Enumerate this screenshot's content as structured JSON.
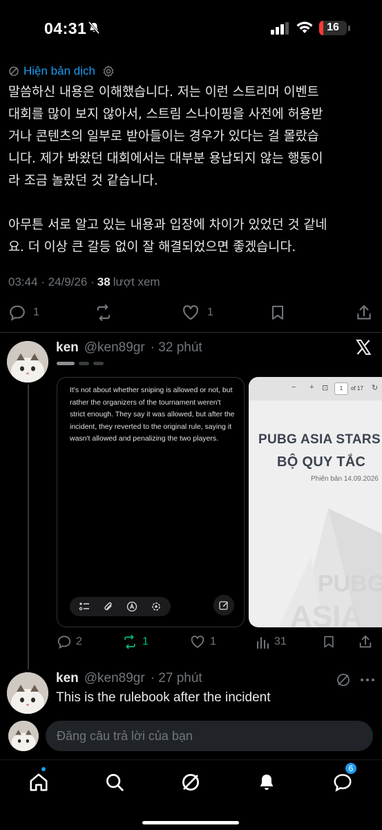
{
  "status_bar": {
    "time": "04:31",
    "battery": "16",
    "battery_level": 0.16
  },
  "tweet": {
    "translate_label": "Hiện bản dịch",
    "text": "말씀하신 내용은 이해했습니다. 저는 이런 스트리머 이벤트\n대회를 많이 보지 않아서, 스트림 스나이핑을 사전에 허용받\n거나 콘텐츠의 일부로 받아들이는 경우가 있다는 걸 몰랐습\n니다. 제가 봐왔던 대회에서는 대부분 용납되지 않는 행동이\n라 조금 놀랐던 것 같습니다.\n\n아무튼 서로 알고 있는 내용과 입장에 차이가 있었던 것 같네\n요. 더 이상 큰 갈등 없이 잘 해결되었으면 좋겠습니다.",
    "timestamp": "03:44 · 24/9/26 ·",
    "views_count": "38",
    "views_label": "lượt xem",
    "replies": "1",
    "likes": "1"
  },
  "reply1": {
    "name": "ken",
    "handle": "@ken89gr",
    "time": "· 32 phút",
    "note_text": "It's not about whether sniping is allowed or not, but rather the organizers of the tournament weren't strict enough. They say it was allowed, but after the incident, they reverted to the original rule, saying it wasn't allowed and penalizing the two players.",
    "pdf": {
      "page": "1",
      "of": "of 17",
      "title1": "PUBG ASIA STARS",
      "title2": "BỘ QUY TẮC",
      "version": "Phiên bản 14.09.2026",
      "watermark1": "PUBG",
      "watermark2": "ASIA"
    },
    "replies": "2",
    "reposts": "1",
    "likes": "1",
    "views": "31",
    "repost_color": "#00ba7c"
  },
  "reply2": {
    "name": "ken",
    "handle": "@ken89gr",
    "time": "· 27 phút",
    "text": "This is the rulebook after the incident"
  },
  "composer": {
    "placeholder": "Đăng câu trả lời của bạn"
  },
  "tabbar": {
    "messages_badge": "6"
  },
  "colors": {
    "accent": "#1d9bf0",
    "muted": "#71767b",
    "text": "#e7e9ea"
  }
}
